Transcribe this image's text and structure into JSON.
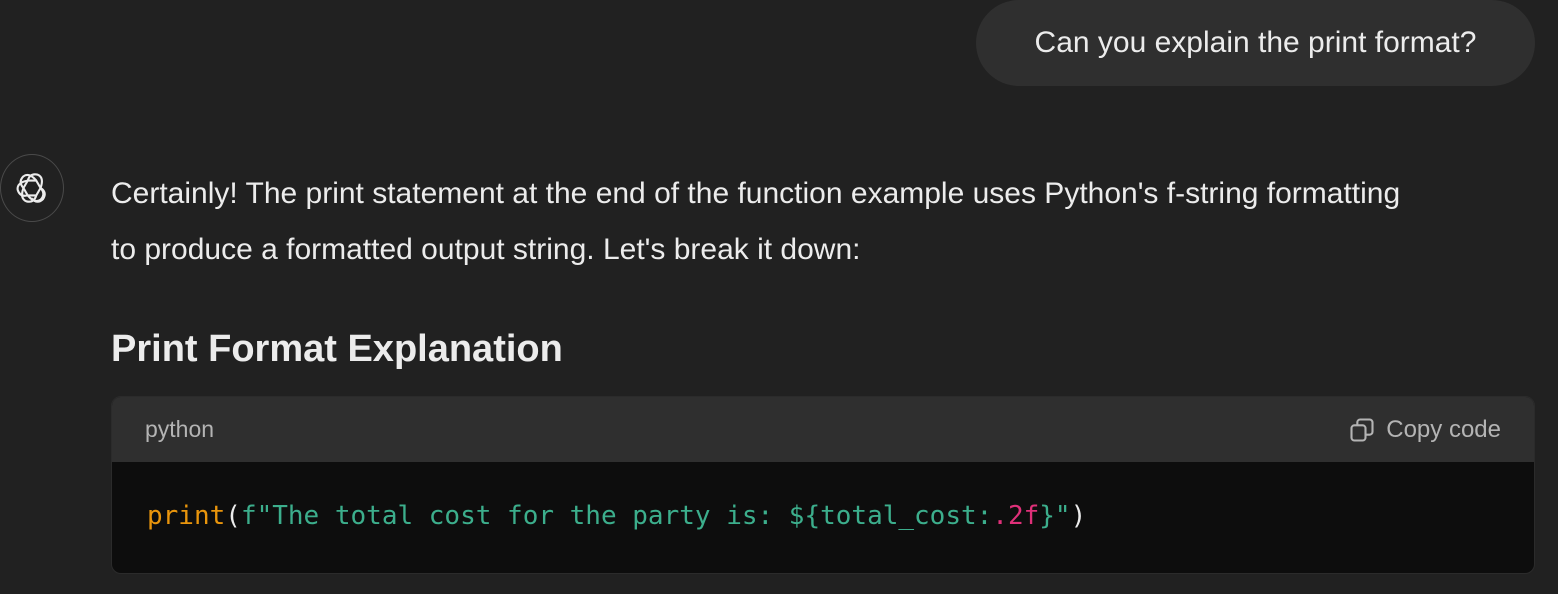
{
  "user_message": "Can you explain the print format?",
  "assistant": {
    "paragraph": "Certainly! The print statement at the end of the function example uses Python's f-string formatting to produce a formatted output string. Let's break it down:",
    "heading": "Print Format Explanation",
    "code_block": {
      "language": "python",
      "copy_label": "Copy code",
      "tokens": {
        "fn": "print",
        "open": "(",
        "str1": "f\"The total cost for the party is: ${total_cost:",
        "num": ".2f",
        "str2": "}\"",
        "close": ")"
      }
    }
  },
  "colors": {
    "background": "#212121",
    "bubble": "#2f2f2f",
    "code_header": "#2f2f2f",
    "code_body": "#0d0d0d",
    "function": "#e9950c",
    "string": "#3cae8c",
    "number": "#df3079"
  },
  "icons": {
    "avatar": "openai-logo-icon",
    "copy": "copy-icon"
  }
}
